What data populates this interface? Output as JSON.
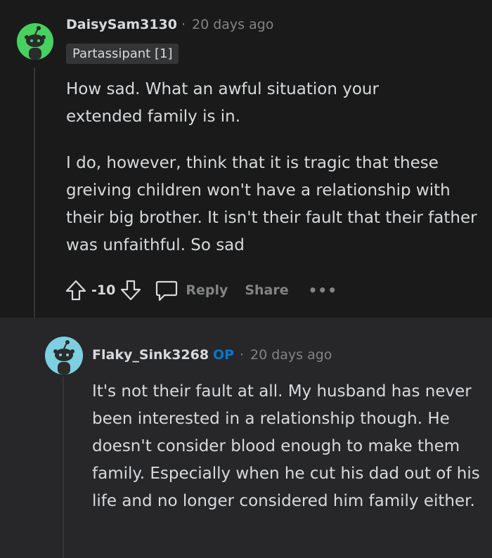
{
  "comments": [
    {
      "username": "DaisySam3130",
      "separator": "·",
      "time": "20 days ago",
      "flair": "Partassipant [1]",
      "paragraphs": [
        "How sad. What an awful situation your extended family is in.",
        "I do, however, think that it is tragic that these greiving children won't have a relationship with their big brother. It isn't their fault that their father was unfaithful. So sad"
      ],
      "score": "-10",
      "reply_label": "Reply",
      "share_label": "Share",
      "more_label": "•••",
      "avatar_color": "#46d160"
    },
    {
      "username": "Flaky_Sink3268",
      "op_badge": "OP",
      "separator": "·",
      "time": "20 days ago",
      "paragraphs": [
        "It's not their fault at all. My husband has never been interested in a relationship though. He doesn't consider blood enough to make them family. Especially when he cut his dad out of his life and no longer considered him family either."
      ],
      "avatar_color": "#7ecfe0"
    }
  ]
}
